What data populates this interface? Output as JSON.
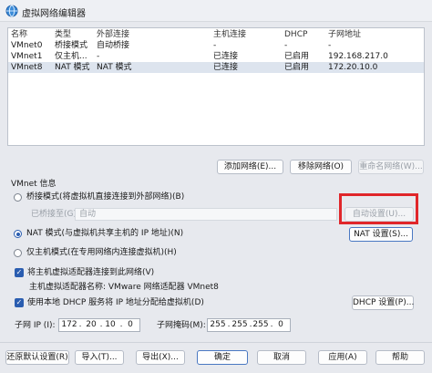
{
  "window": {
    "title": "虚拟网络编辑器"
  },
  "table": {
    "headers": [
      "名称",
      "类型",
      "外部连接",
      "主机连接",
      "DHCP",
      "子网地址"
    ],
    "rows": [
      [
        "VMnet0",
        "桥接模式",
        "自动桥接",
        "-",
        "-",
        "-"
      ],
      [
        "VMnet1",
        "仅主机...",
        "-",
        "已连接",
        "已启用",
        "192.168.217.0"
      ],
      [
        "VMnet8",
        "NAT 模式",
        "NAT 模式",
        "已连接",
        "已启用",
        "172.20.10.0"
      ]
    ]
  },
  "table_buttons": {
    "add": "添加网络(E)...",
    "remove": "移除网络(O)",
    "rename": "重命名网络(W)..."
  },
  "vmnet_info": {
    "group_label": "VMnet 信息",
    "bridge_option": "桥接模式(将虚拟机直接连接到外部网络)(B)",
    "bridged_to_label": "已桥接至(G):",
    "bridged_to_value": "自动",
    "auto_settings": "自动设置(U)...",
    "nat_option": "NAT 模式(与虚拟机共享主机的 IP 地址)(N)",
    "nat_settings": "NAT 设置(S)...",
    "hostonly_option": "仅主机模式(在专用网络内连接虚拟机)(H)",
    "connect_adapter": "将主机虚拟适配器连接到此网络(V)",
    "adapter_name": "主机虚拟适配器名称: VMware 网络适配器 VMnet8",
    "use_dhcp": "使用本地 DHCP 服务将 IP 地址分配给虚拟机(D)",
    "dhcp_settings": "DHCP 设置(P)...",
    "subnet_ip_label": "子网 IP (I):",
    "subnet_ip": [
      "172",
      "20",
      "10",
      "0"
    ],
    "subnet_mask_label": "子网掩码(M):",
    "subnet_mask": [
      "255",
      "255",
      "255",
      "0"
    ]
  },
  "footer": {
    "restore": "还原默认设置(R)",
    "import": "导入(T)...",
    "export": "导出(X)...",
    "ok": "确定",
    "cancel": "取消",
    "apply": "应用(A)",
    "help": "帮助"
  }
}
